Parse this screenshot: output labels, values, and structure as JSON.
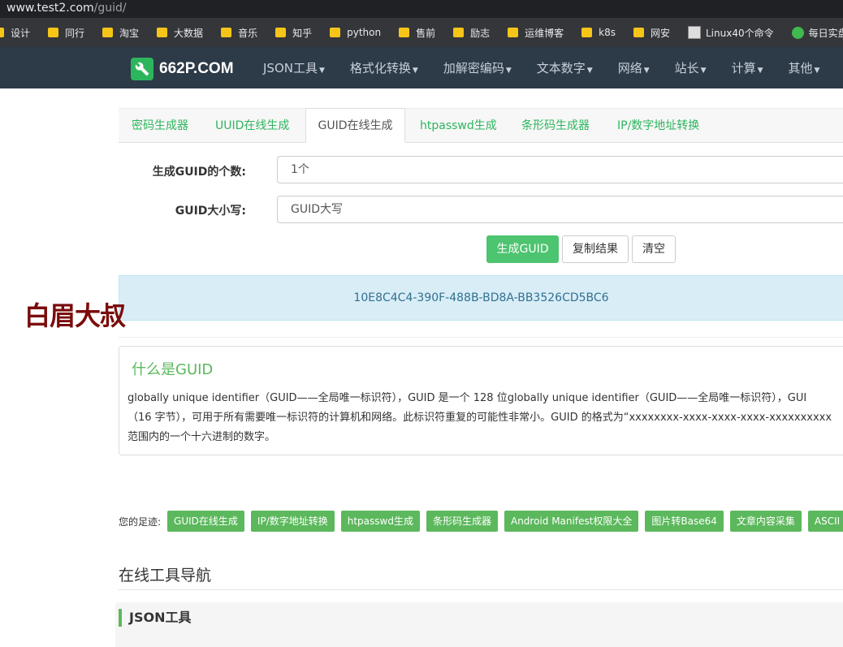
{
  "browser": {
    "url_main": "www.test2.com",
    "url_path": "/guid/",
    "bookmarks": [
      "设计",
      "同行",
      "淘宝",
      "大数据",
      "音乐",
      "知乎",
      "python",
      "售前",
      "励志",
      "运维博客",
      "k8s",
      "网安"
    ],
    "bookmark_special_1": "Linux40个命令",
    "bookmark_special_2": "每日实盘 · 语雀"
  },
  "nav": {
    "brand": "662P.COM",
    "items": [
      "JSON工具",
      "格式化转换",
      "加解密编码",
      "文本数字",
      "网络",
      "站长",
      "计算",
      "其他"
    ]
  },
  "tabs": [
    "密码生成器",
    "UUID在线生成",
    "GUID在线生成",
    "htpasswd生成",
    "条形码生成器",
    "IP/数字地址转换"
  ],
  "form": {
    "count_label": "生成GUID的个数:",
    "count_value": "1个",
    "case_label": "GUID大小写:",
    "case_value": "GUID大写"
  },
  "buttons": {
    "generate": "生成GUID",
    "copy": "复制结果",
    "clear": "清空"
  },
  "result": "10E8C4C4-390F-488B-BD8A-BB3526CD5BC6",
  "watermark": "白眉大叔",
  "info": {
    "title": "什么是GUID",
    "line1": "globally unique identifier（GUID——全局唯一标识符），GUID 是一个 128 位globally unique identifier（GUID——全局唯一标识符），GUI",
    "line2": "（16 字节），可用于所有需要唯一标识符的计算机和网络。此标识符重复的可能性非常小。GUID 的格式为“xxxxxxxx-xxxx-xxxx-xxxx-xxxxxxxxxx",
    "line3": "范围内的一个十六进制的数字。"
  },
  "trail": {
    "label": "您的足迹:",
    "items": [
      "GUID在线生成",
      "IP/数字地址转换",
      "htpasswd生成",
      "条形码生成器",
      "Android Manifest权限大全",
      "图片转Base64",
      "文章内容采集",
      "ASCII"
    ]
  },
  "section": {
    "title": "在线工具导航",
    "subtitle": "JSON工具"
  }
}
